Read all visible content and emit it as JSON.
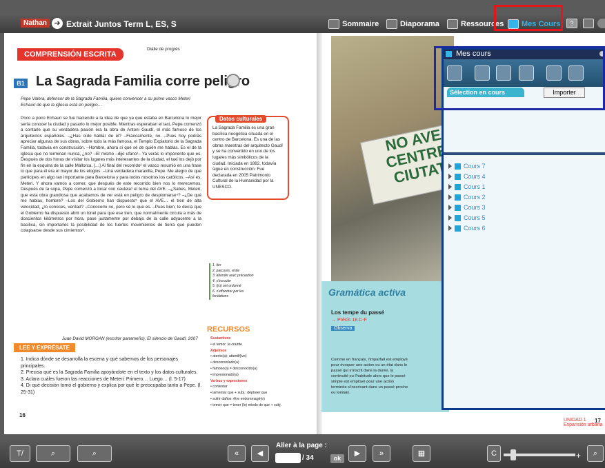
{
  "topbar": {
    "brand": "Nathan",
    "title": "Extrait Juntos Term L, ES, S",
    "buttons": [
      "Sommaire",
      "Diaporama",
      "Ressources",
      "Mes Cours"
    ],
    "icons": [
      "help-icon",
      "fullscreen-icon",
      "close-icon"
    ]
  },
  "left_page": {
    "section": "COMPRENSIÓN ESCRITA",
    "progress_note": "Diálle de progrès",
    "number": "B1",
    "heading": "La Sagrada Familia corre peligro",
    "intro": "Pepe Valera, defensor de la Sagrada Familia, quiere convencer a su primo vasco Meteri Echauri de que la iglesia está en peligro…",
    "paragraph": "Poco a poco Echauri se fue haciendo a la idea de que ya que estaba en Barcelona lo mejor sería conocer la ciudad y pasarlo lo mejor posible. Mientras esperaban el taxi, Pepe comenzó a contarle que su verdadera pasión era la obra de Antoni Gaudí, el más famoso de los arquitectos españoles. –¿Has oído hablar de él? –Francamente, no. –Pues hoy podrás apreciar algunas de sus obras, sobre todo la más famosa, el Templo Expiatorio de la Sagrada Familia, todavía en construcción. –Hombre, ahora sí que sé de quién me hablas. Es el de la iglesia que no terminan nunca, ¿no? –El mismo –dijo ufano¹– Ya verás lo imponente que es. Después de dos horas de visitar los lugares más interesantes de la ciudad, el taxi los dejó por fin en la esquina de la calle Mallorca. […] Al final del recorrido² el vasco resumió en una frase lo que para él era el mayor de los elogios: –Una verdadera maravilla, Pepe. Me alegro de que participes en algo tan importante para Barcelona y para todos nosotros los católicos. –Así es, Meteri. Y ahora vamos a comer, que después de este recorrido bien nos lo merecemos. Después de la sopa, Pepe comenzó a tocar con cautela³ el tema del AVE. –¿Sabes, Meteri, que esta obra grandiosa que acabamos de ver está en peligro de desplomarse⁴? –¿De qué me hablas, hombre? –Los del Gobierno han dispuesto⁵ que el AVE… el tren de alta velocidad, ¿lo conoces, verdad? –Conocerlo no, pero sé lo que es. –Pues bien, te decía que el Gobierno ha dispuesto abrir un túnel para que ese tren, que normalmente circula a más de doscientos kilómetros por hora, pase justamente por debajo de la calle adyacente a la basílica, sin importarles la posibilidad de los fuertes movimientos de tierra que pueden colapsarse desde sus cimientos⁶.",
    "attribution": "Juan David MORGAN (escritor panameño), El silencio de Gaudí, 2007",
    "note_tag": "Datos culturales",
    "note_text": "La Sagrada Familia es una gran basílica neogótica situada en el centro de Barcelona. Es una de las obras maestras del arquitecto Gaudí y se ha convertido en uno de los lugares más simbólicos de la ciudad. Iniciada en 1882, todavía sigue en construcción. Fue declarada en 2005 Patrimonio Cultural de la Humanidad por la UNESCO.",
    "glossary": [
      "1. fier",
      "2. parcours, visite",
      "3. aborder avec précaution",
      "4. s'écrouler",
      "5. (ici) ont ordonné",
      "6. s'effondrer par les fondations"
    ],
    "recursos_title": "RECURSOS",
    "recursos_items": [
      "Sustantivos",
      "• el temor: la crainte",
      "Adjetivos",
      "• atento(a): attentif(ive)",
      "• desconsolado(a)",
      "• famoso(a) ≠ desconocido(a)",
      "• impresionado(a)",
      "Verbos y expresiones",
      "• contestar",
      "• lamentar que + subj.: déplorer que",
      "• sufrir daños: être endommagé(e)",
      "• temer que = tener (le) miedo de que + subj."
    ],
    "exercises_title": "LEE Y EXPRÉSATE",
    "exercises": [
      "1. Indica dónde se desarrolla la escena y qué sabemos de los personajes principales.",
      "2. Precisa qué es la Sagrada Familia apoyándote en el texto y los datos culturales.",
      "3. Aclara cuáles fueron las reacciones de Meteri: Primero… Luego… (l. 5-17)",
      "4. Di qué decisión tomó el gobierno y explica por qué le preocupaba tanto a Pepe. (l. 25-31)"
    ],
    "page_number": "16"
  },
  "right_page": {
    "banner_lines": [
      "NO AVE",
      "CENTRE",
      "CIUTAT"
    ],
    "grammar_title": "Gramática activa",
    "grammar_subtitle": "Los tempe du passé",
    "grammar_ref": "→ Précis 18.C-F",
    "grammar_observe": "Observa",
    "grammar_text": "Comme en français, l'imparfait est employé pour évoquer une action ou un état dans le passé qui s'inscrit dans la durée, la continuité ou l'habitude alors que le passé simple est employé pour une action terminée s'inscrivant dans un passé proche ou lointain.",
    "unidad": "UNIDAD 1 Expansión urbana",
    "page_number": "17"
  },
  "panel": {
    "title": "Mes cours",
    "tab_selected": "Sélection en cours",
    "import_button": "Importer",
    "tools": [
      "add-icon",
      "attach-icon",
      "camera-icon",
      "list-icon",
      "download-icon",
      "export-icon"
    ],
    "cours": [
      "Cours 7",
      "Cours 4",
      "Cours 1",
      "Cours 2",
      "Cours 3",
      "Cours 5",
      "Cours 6"
    ]
  },
  "bottombar": {
    "goto_label": "Aller à la page :",
    "goto_value": "",
    "total": "/ 34",
    "ok": "ok"
  },
  "colors": {
    "accent_red": "#e8141b",
    "panel_blue": "#1a2aa0",
    "cours_text": "#3a8bc4"
  }
}
